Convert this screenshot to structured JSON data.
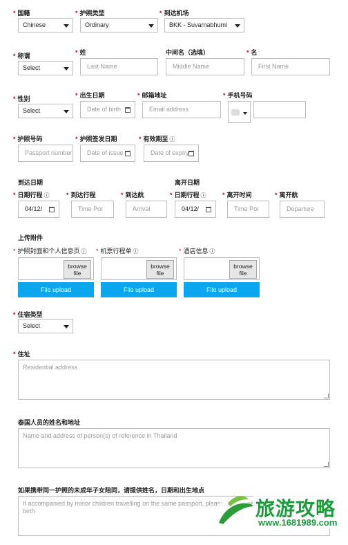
{
  "row1": {
    "nationality_label": "国籍",
    "nationality_value": "Chinese",
    "passport_type_label": "护照类型",
    "passport_type_value": "Ordinary",
    "arrival_airport_label": "到达机场",
    "arrival_airport_value": "BKK - Suvarnabhumi"
  },
  "row2": {
    "title_label": "称谓",
    "title_value": "Select",
    "surname_label": "姓",
    "surname_placeholder": "Last Name",
    "middle_label": "中间名（选填）",
    "middle_placeholder": "Middle Name",
    "given_label": "名",
    "given_placeholder": "First Name"
  },
  "row3": {
    "gender_label": "性别",
    "gender_value": "Select",
    "dob_label": "出生日期",
    "dob_placeholder": "Date of birth",
    "email_label": "邮箱地址",
    "email_placeholder": "Email address",
    "phone_label": "手机号码"
  },
  "row4": {
    "passport_no_label": "护照号码",
    "passport_no_placeholder": "Passport number",
    "issue_label": "护照签发日期",
    "issue_placeholder": "Date of issue",
    "expiry_label": "有效期至",
    "expiry_placeholder": "Date of expiry"
  },
  "arrival": {
    "heading": "到达日期",
    "itinerary_label": "日期行程",
    "itinerary_value": "04/12/",
    "time_label": "到达行程",
    "time_placeholder": "Time Por",
    "flight_label": "到达航",
    "flight_placeholder": "Arrival"
  },
  "departure": {
    "heading": "离开日期",
    "itinerary_label": "日期行程",
    "itinerary_value": "04/12/",
    "time_label": "离开时间",
    "time_placeholder": "Time Por",
    "flight_label": "离开航",
    "flight_placeholder": "Departure"
  },
  "uploads": {
    "heading": "上传附件",
    "browse_label": "browse file",
    "button_label": "File upload",
    "items": [
      {
        "label": "护照封面和个人信息页"
      },
      {
        "label": "机票行程单"
      },
      {
        "label": "酒店信息"
      }
    ]
  },
  "accommodation": {
    "label": "住宿类型",
    "value": "Select"
  },
  "address": {
    "label": "住址",
    "placeholder": "Residential address"
  },
  "reference": {
    "label": "泰国人员的姓名和地址",
    "placeholder": "Name and address of person(s) of reference in Thailand"
  },
  "minors": {
    "label": "如果携带同一护照的未成年子女陪同，请提供姓名，日期和出生地点",
    "placeholder": "If accompanied by minor children travelling on the same passport, please give names, dates and places of birth"
  },
  "watermark": {
    "text": "旅游攻略",
    "url": "www.1681989.com"
  },
  "colors": {
    "required": "#d0021b",
    "upload_button": "#0aa7ee",
    "watermark": "#1e9b3e"
  }
}
